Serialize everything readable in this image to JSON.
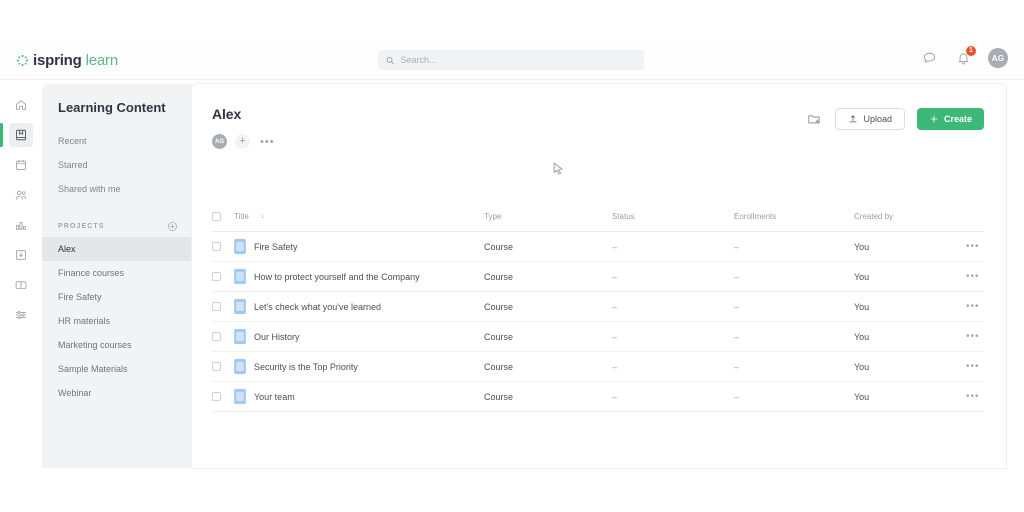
{
  "brand": {
    "name_bold": "ispring",
    "name_light": "learn",
    "accent_green": "#3cb878",
    "badge_red": "#e8502e"
  },
  "search": {
    "placeholder": "Search...",
    "value": ""
  },
  "topbar": {
    "chat_label": "Chat",
    "notifications_label": "Notifications",
    "notification_count": "1",
    "avatar_initials": "AG"
  },
  "rail": {
    "items": [
      {
        "name": "home",
        "label": "Home",
        "active": false
      },
      {
        "name": "learning-content",
        "label": "Learning Content",
        "active": true
      },
      {
        "name": "calendar",
        "label": "Calendar",
        "active": false
      },
      {
        "name": "users",
        "label": "Users",
        "active": false
      },
      {
        "name": "reports",
        "label": "Reports",
        "active": false
      },
      {
        "name": "certificates",
        "label": "Certificates",
        "active": false
      },
      {
        "name": "knowledge-base",
        "label": "Knowledge Base",
        "active": false
      },
      {
        "name": "settings",
        "label": "Settings",
        "active": false
      }
    ]
  },
  "sidebar": {
    "title": "Learning Content",
    "links": [
      {
        "label": "Recent"
      },
      {
        "label": "Starred"
      },
      {
        "label": "Shared with me"
      }
    ],
    "section_label": "PROJECTS",
    "add_project_label": "Add project",
    "projects": [
      {
        "label": "Alex",
        "active": true
      },
      {
        "label": "Finance courses",
        "active": false
      },
      {
        "label": "Fire Safety",
        "active": false
      },
      {
        "label": "HR materials",
        "active": false
      },
      {
        "label": "Marketing courses",
        "active": false
      },
      {
        "label": "Sample Materials",
        "active": false
      },
      {
        "label": "Webinar",
        "active": false
      }
    ]
  },
  "main": {
    "title": "Alex",
    "owner_initials": "AG",
    "add_member_label": "+",
    "more_label": "•••",
    "new_folder_label": "New folder",
    "upload_label": "Upload",
    "create_label": "Create"
  },
  "table": {
    "columns": {
      "title": "Title",
      "sort_indicator": "↓",
      "type": "Type",
      "status": "Status",
      "enrollments": "Enrollments",
      "created_by": "Created by"
    },
    "rows": [
      {
        "title": "Fire Safety",
        "type": "Course",
        "status": "–",
        "enrollments": "–",
        "created_by": "You",
        "menu": "•••"
      },
      {
        "title": "How to protect yourself and the Company",
        "type": "Course",
        "status": "–",
        "enrollments": "–",
        "created_by": "You",
        "menu": "•••"
      },
      {
        "title": "Let's check what you've learned",
        "type": "Course",
        "status": "–",
        "enrollments": "–",
        "created_by": "You",
        "menu": "•••"
      },
      {
        "title": "Our History",
        "type": "Course",
        "status": "–",
        "enrollments": "–",
        "created_by": "You",
        "menu": "•••"
      },
      {
        "title": "Security is the Top Priority",
        "type": "Course",
        "status": "–",
        "enrollments": "–",
        "created_by": "You",
        "menu": "•••"
      },
      {
        "title": "Your team",
        "type": "Course",
        "status": "–",
        "enrollments": "–",
        "created_by": "You",
        "menu": "•••"
      }
    ]
  }
}
